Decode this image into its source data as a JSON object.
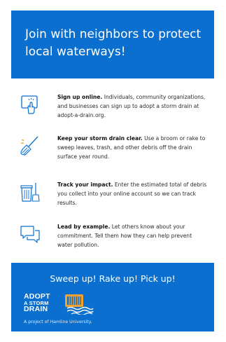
{
  "header": {
    "title": "Join with neighbors to protect local waterways!"
  },
  "steps": [
    {
      "icon": "hand-tap-icon",
      "title": "Sign up online.",
      "body": " Individuals, community organizations, and businesses can sign up to adopt a storm drain at adopt-a-drain.org."
    },
    {
      "icon": "broom-icon",
      "title": "Keep your storm drain clear.",
      "body": " Use a broom or rake to sweep leaves, trash, and other debris off the drain surface year round."
    },
    {
      "icon": "trash-can-broom-icon",
      "title": "Track your impact.",
      "body": " Enter the estimated total of debris you collect into your online account so we can track results."
    },
    {
      "icon": "chat-bubbles-icon",
      "title": "Lead by example.",
      "body": " Let others know about your commitment. Tell them how they can help prevent water pollution."
    }
  ],
  "footer": {
    "tagline": "Sweep up! Rake up! Pick up!",
    "logo_line1": "ADOPT",
    "logo_line2": "A STORM",
    "logo_line3": "DRAIN",
    "project": "A project of Hamline University."
  },
  "colors": {
    "brand_blue": "#0a6fce",
    "logo_orange": "#f2a22e"
  }
}
